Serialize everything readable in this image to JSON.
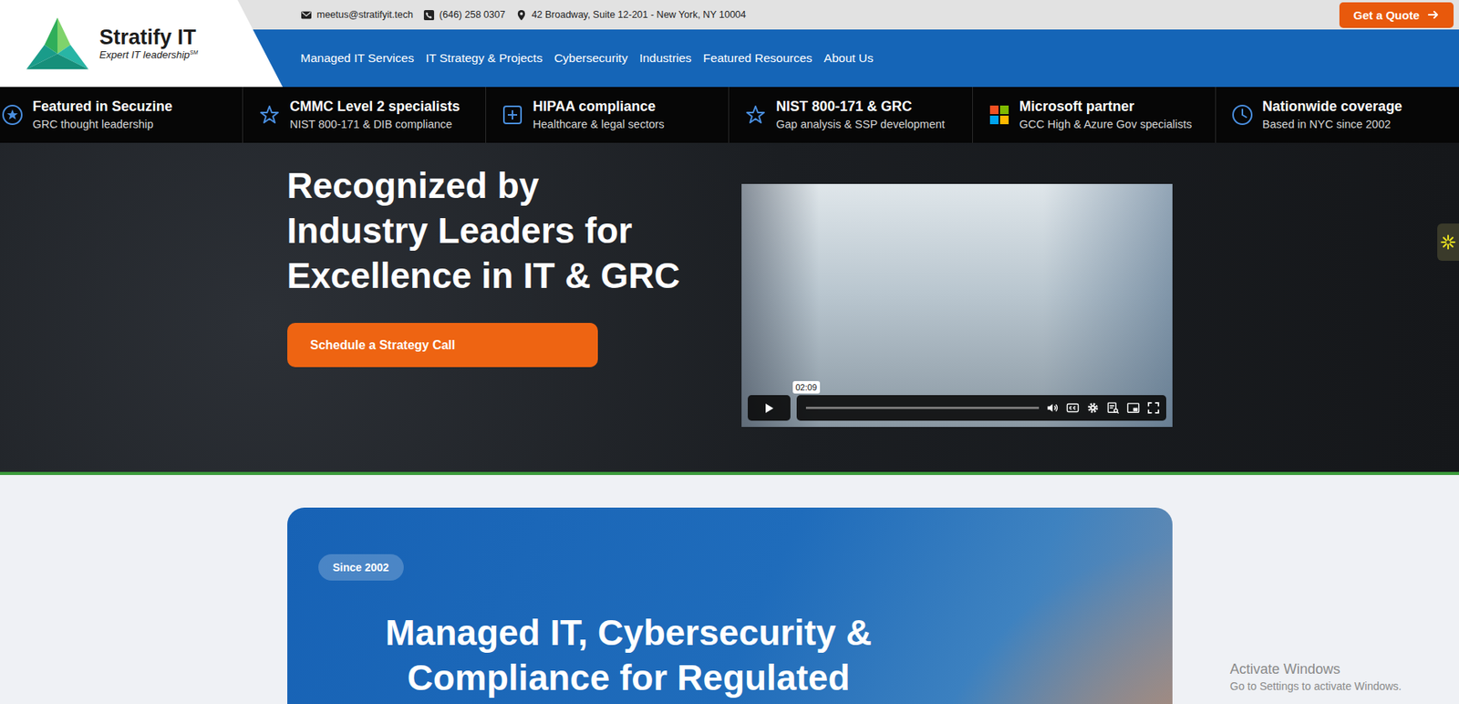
{
  "logo": {
    "name": "Stratify IT",
    "tagline": "Expert IT leadership",
    "mark": "SM"
  },
  "contact": {
    "email": "meetus@stratifyit.tech",
    "phone": "(646) 258 0307",
    "address": "42 Broadway, Suite 12-201 - New York, NY 10004"
  },
  "quote_button": {
    "label": "Get a Quote"
  },
  "nav": [
    {
      "label": "Managed IT Services"
    },
    {
      "label": "IT Strategy & Projects"
    },
    {
      "label": "Cybersecurity"
    },
    {
      "label": "Industries"
    },
    {
      "label": "Featured Resources"
    },
    {
      "label": "About Us"
    }
  ],
  "highlights": [
    {
      "kind": "star-circle",
      "title": "Featured in Secuzine",
      "subtitle": "GRC thought leadership"
    },
    {
      "kind": "star",
      "title": "CMMC Level 2 specialists",
      "subtitle": "NIST 800-171 & DIB compliance"
    },
    {
      "kind": "plus",
      "title": "HIPAA compliance",
      "subtitle": "Healthcare & legal sectors"
    },
    {
      "kind": "star",
      "title": "NIST 800-171 & GRC",
      "subtitle": "Gap analysis & SSP development"
    },
    {
      "kind": "microsoft",
      "title": "Microsoft partner",
      "subtitle": "GCC High & Azure Gov specialists"
    },
    {
      "kind": "clock",
      "title": "Nationwide coverage",
      "subtitle": "Based in NYC since 2002"
    }
  ],
  "hero": {
    "title_lines": [
      "Recognized by",
      "Industry Leaders for",
      "Excellence in IT & GRC"
    ],
    "cta": "Schedule a Strategy Call"
  },
  "video": {
    "time": "02:09",
    "level": 0
  },
  "intro": {
    "badge": "Since 2002",
    "title_lines": [
      "Managed IT, Cybersecurity &",
      "Compliance for Regulated"
    ]
  },
  "watermark": {
    "title": "Activate Windows",
    "subtitle": "Go to Settings to activate Windows."
  }
}
